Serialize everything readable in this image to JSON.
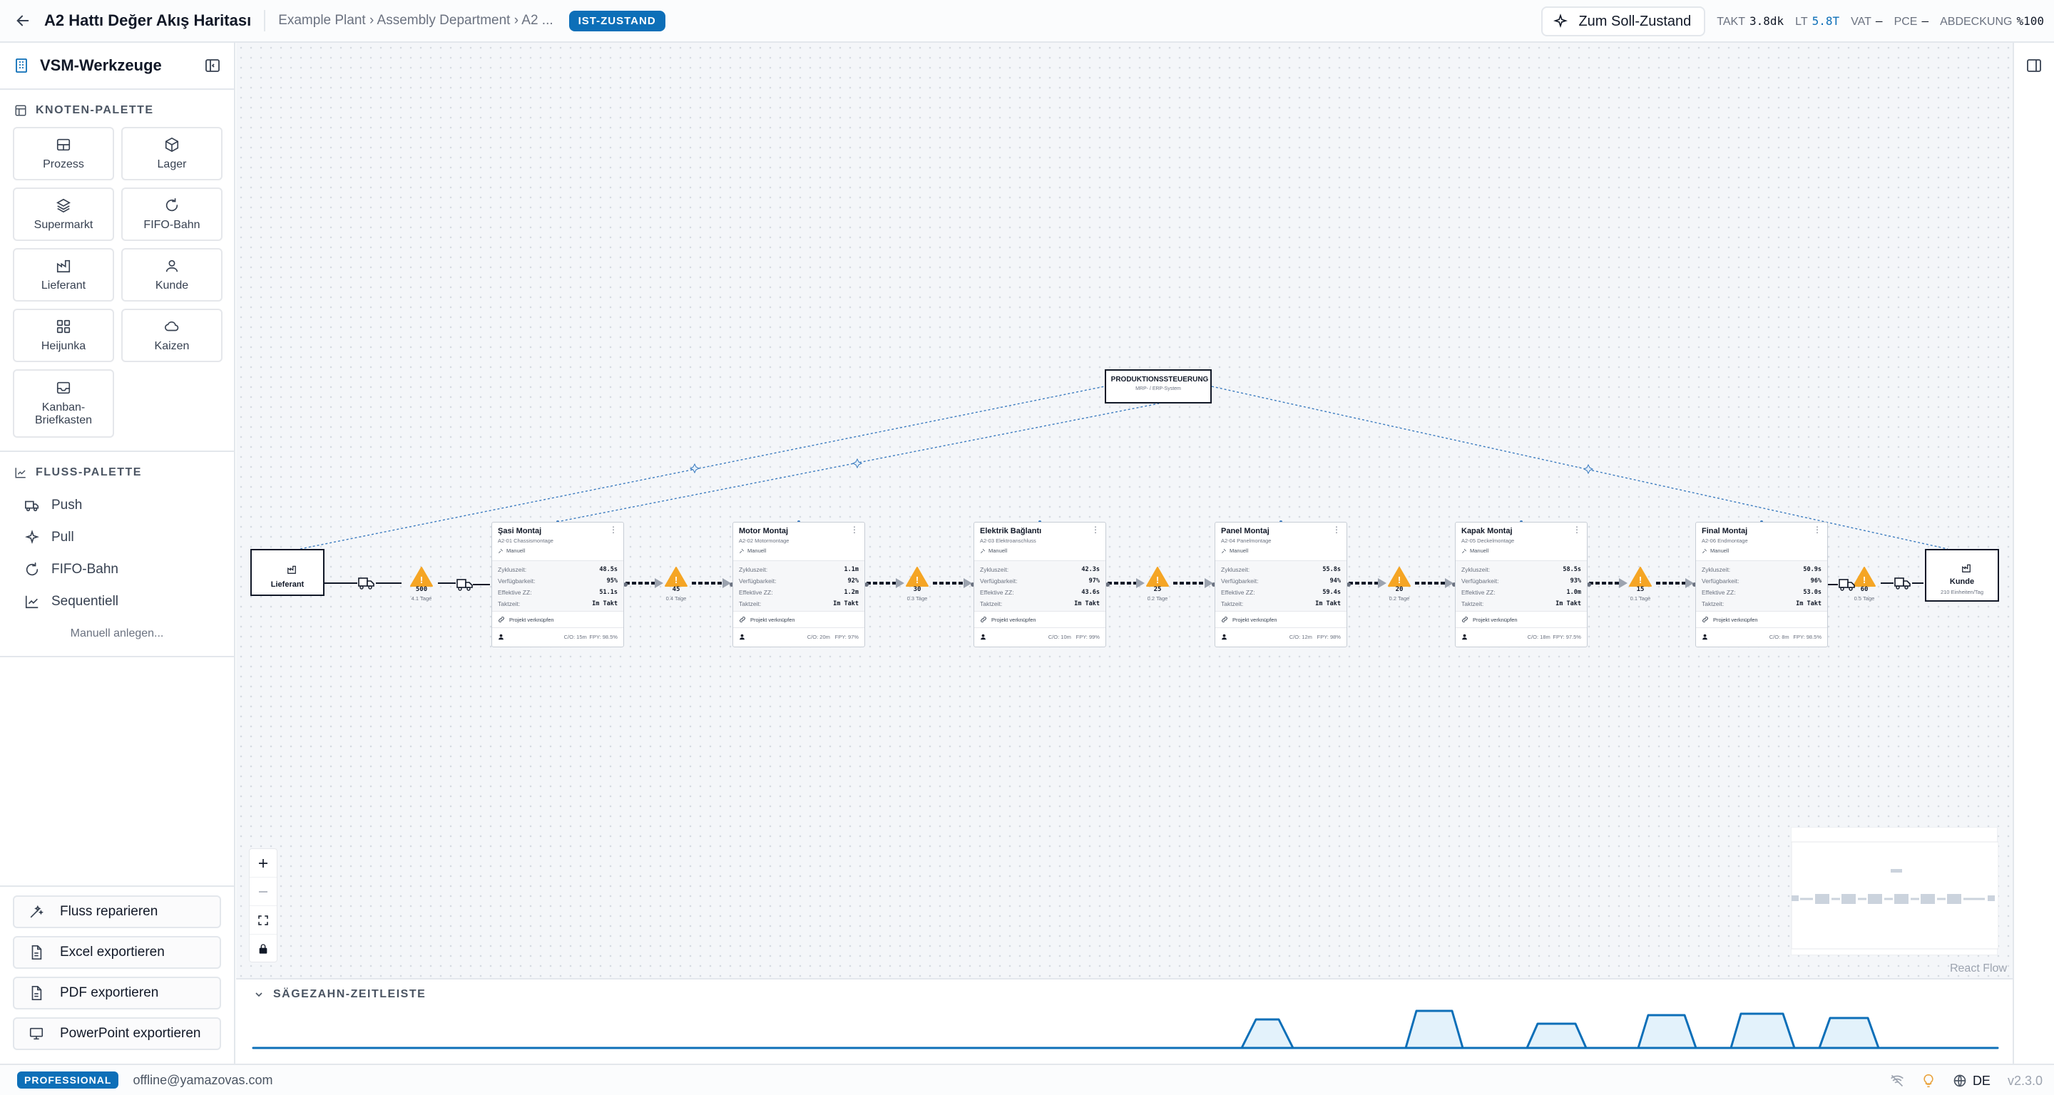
{
  "header": {
    "title": "A2 Hattı Değer Akış Haritası",
    "breadcrumb": "Example Plant › Assembly Department › A2 ...",
    "state_badge": "IST-ZUSTAND",
    "target_button": "Zum Soll-Zustand",
    "metrics": [
      {
        "label": "TAKT",
        "value": "3.8dk",
        "accent": false
      },
      {
        "label": "LT",
        "value": "5.8T",
        "accent": true
      },
      {
        "label": "VAT",
        "value": "—",
        "accent": false
      },
      {
        "label": "PCE",
        "value": "—",
        "accent": false
      },
      {
        "label": "ABDECKUNG",
        "value": "%100",
        "accent": false
      }
    ]
  },
  "sidebar": {
    "title": "VSM-Werkzeuge",
    "node_palette_title": "KNOTEN-PALETTE",
    "node_palette": [
      {
        "label": "Prozess",
        "icon": "process-icon"
      },
      {
        "label": "Lager",
        "icon": "box-icon"
      },
      {
        "label": "Supermarkt",
        "icon": "layers-icon"
      },
      {
        "label": "FIFO-Bahn",
        "icon": "refresh-icon"
      },
      {
        "label": "Lieferant",
        "icon": "factory-icon"
      },
      {
        "label": "Kunde",
        "icon": "user-icon"
      },
      {
        "label": "Heijunka",
        "icon": "grid-icon"
      },
      {
        "label": "Kaizen",
        "icon": "cloud-icon"
      },
      {
        "label": "Kanban-Briefkasten",
        "icon": "inbox-icon"
      }
    ],
    "flow_palette_title": "FLUSS-PALETTE",
    "flow_palette": [
      {
        "label": "Push",
        "icon": "truck-icon"
      },
      {
        "label": "Pull",
        "icon": "sparkle-icon"
      },
      {
        "label": "FIFO-Bahn",
        "icon": "refresh-icon"
      },
      {
        "label": "Sequentiell",
        "icon": "chart-line-icon"
      }
    ],
    "manual_link": "Manuell anlegen...",
    "actions": [
      {
        "label": "Fluss reparieren",
        "icon": "wand-icon"
      },
      {
        "label": "Excel exportieren",
        "icon": "file-icon"
      },
      {
        "label": "PDF exportieren",
        "icon": "file-icon"
      },
      {
        "label": "PowerPoint exportieren",
        "icon": "presentation-icon"
      }
    ]
  },
  "canvas": {
    "control_node": {
      "title": "PRODUKTIONSSTEUERUNG",
      "subtitle": "MRP- / ERP-System"
    },
    "supplier": {
      "label": "Lieferant"
    },
    "customer": {
      "label": "Kunde",
      "subtitle": "210 Einheiten/Tag"
    },
    "field_labels": {
      "cycle": "Zykluszeit:",
      "availability": "Verfügbarkeit:",
      "effective": "Effektive ZZ:",
      "takt": "Taktzeit:",
      "link_project": "Projekt verknüpfen"
    },
    "processes": [
      {
        "name": "Şasi Montaj",
        "code": "A2-01 Chassismontage",
        "tag": "Manuell",
        "cycle": "48.5s",
        "availability": "95%",
        "effective": "51.1s",
        "takt": "Im Takt",
        "co": "C/O: 15m",
        "fpy": "FPY: 98.5%"
      },
      {
        "name": "Motor Montaj",
        "code": "A2-02 Motormontage",
        "tag": "Manuell",
        "cycle": "1.1m",
        "availability": "92%",
        "effective": "1.2m",
        "takt": "Im Takt",
        "co": "C/O: 20m",
        "fpy": "FPY: 97%"
      },
      {
        "name": "Elektrik Bağlantı",
        "code": "A2-03 Elektroanschluss",
        "tag": "Manuell",
        "cycle": "42.3s",
        "availability": "97%",
        "effective": "43.6s",
        "takt": "Im Takt",
        "co": "C/O: 10m",
        "fpy": "FPY: 99%"
      },
      {
        "name": "Panel Montaj",
        "code": "A2-04 Panelmontage",
        "tag": "Manuell",
        "cycle": "55.8s",
        "availability": "94%",
        "effective": "59.4s",
        "takt": "Im Takt",
        "co": "C/O: 12m",
        "fpy": "FPY: 98%"
      },
      {
        "name": "Kapak Montaj",
        "code": "A2-05 Deckelmontage",
        "tag": "Manuell",
        "cycle": "58.5s",
        "availability": "93%",
        "effective": "1.0m",
        "takt": "Im Takt",
        "co": "C/O: 18m",
        "fpy": "FPY: 97.5%"
      },
      {
        "name": "Final Montaj",
        "code": "A2-06 Endmontage",
        "tag": "Manuell",
        "cycle": "50.9s",
        "availability": "96%",
        "effective": "53.0s",
        "takt": "Im Takt",
        "co": "C/O: 8m",
        "fpy": "FPY: 98.5%"
      }
    ],
    "inventories": [
      {
        "qty": "500",
        "days": "4.1 Tage"
      },
      {
        "qty": "45",
        "days": "0.4 Tage"
      },
      {
        "qty": "30",
        "days": "0.3 Tage"
      },
      {
        "qty": "25",
        "days": "0.2 Tage"
      },
      {
        "qty": "20",
        "days": "0.2 Tage"
      },
      {
        "qty": "15",
        "days": "0.1 Tage"
      },
      {
        "qty": "60",
        "days": "0.5 Tage"
      }
    ],
    "attribution": "React Flow"
  },
  "timeline": {
    "title": "SÄGEZAHN-ZEITLEISTE"
  },
  "status": {
    "plan": "PROFESSIONAL",
    "email": "offline@yamazovas.com",
    "language": "DE",
    "version": "v2.3.0"
  }
}
